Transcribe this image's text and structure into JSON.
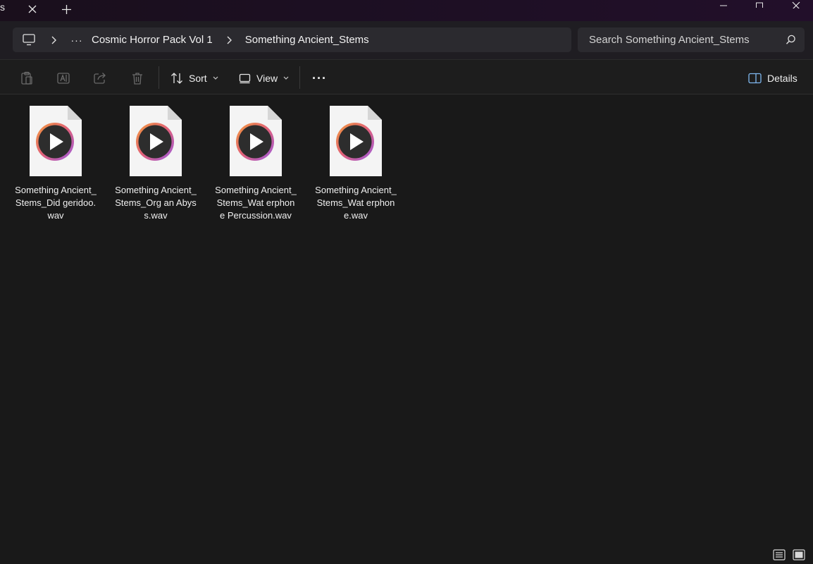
{
  "titlebar": {
    "tab_fragment": "s",
    "tab_close_glyph": "✕",
    "new_tab_glyph": "+"
  },
  "window_controls": {
    "minimize": "—",
    "maximize": "☐",
    "close": "✕"
  },
  "breadcrumb": {
    "overflow": "···",
    "items": [
      "Cosmic Horror Pack Vol 1",
      "Something Ancient_Stems"
    ]
  },
  "search": {
    "placeholder": "Search Something Ancient_Stems"
  },
  "toolbar": {
    "sort_label": "Sort",
    "view_label": "View",
    "more_label": "···",
    "details_label": "Details"
  },
  "files": [
    {
      "name": "Something Ancient_Stems_Didgeridoo.wav",
      "display": "Something Ancient_Stems_Did geridoo.wav"
    },
    {
      "name": "Something Ancient_Stems_Organ Abyss.wav",
      "display": "Something Ancient_Stems_Org an Abyss.wav"
    },
    {
      "name": "Something Ancient_Stems_Waterphone Percussion.wav",
      "display": "Something Ancient_Stems_Wat erphone Percussion.wav"
    },
    {
      "name": "Something Ancient_Stems_Waterphone.wav",
      "display": "Something Ancient_Stems_Wat erphone.wav"
    }
  ],
  "icons": {
    "file_type": "audio-file-icon",
    "accent": "#e0784a",
    "accent2": "#a560d8"
  }
}
